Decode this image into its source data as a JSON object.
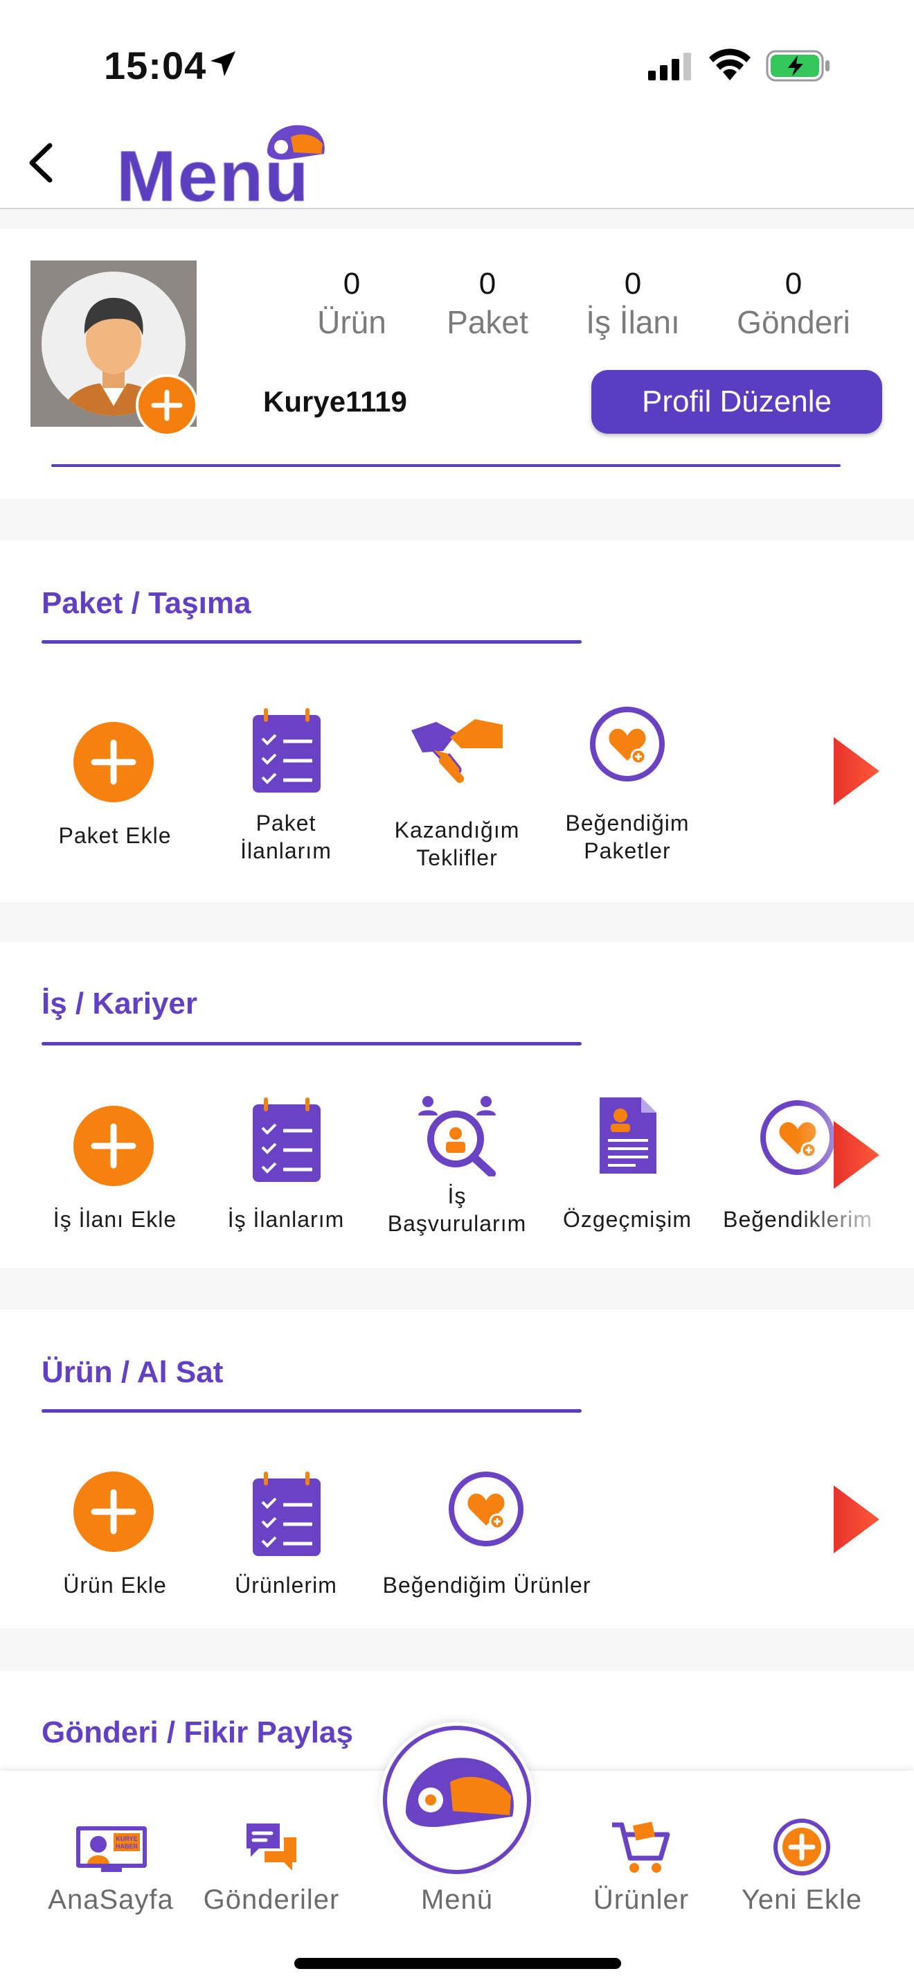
{
  "status_bar": {
    "time": "15:04"
  },
  "header": {
    "logo_text": "Menu"
  },
  "profile": {
    "username": "Kurye1119",
    "edit_label": "Profil Düzenle",
    "stats": [
      {
        "value": "0",
        "label": "Ürün"
      },
      {
        "value": "0",
        "label": "Paket"
      },
      {
        "value": "0",
        "label": "İş İlanı"
      },
      {
        "value": "0",
        "label": "Gönderi"
      }
    ]
  },
  "sections": [
    {
      "title": "Paket / Taşıma",
      "items": [
        {
          "line1": "Paket Ekle",
          "line2": "",
          "icon": "plus-icon"
        },
        {
          "line1": "Paket",
          "line2": "İlanlarım",
          "icon": "clipboard-list-icon"
        },
        {
          "line1": "Kazandığım",
          "line2": "Teklifler",
          "icon": "handshake-icon"
        },
        {
          "line1": "Beğendiğim",
          "line2": "Paketler",
          "icon": "heart-plus-icon"
        }
      ]
    },
    {
      "title": "İş / Kariyer",
      "items": [
        {
          "line1": "İş İlanı Ekle",
          "line2": "",
          "icon": "plus-icon"
        },
        {
          "line1": "İş İlanlarım",
          "line2": "",
          "icon": "clipboard-list-icon"
        },
        {
          "line1": "İş",
          "line2": "Başvurularım",
          "icon": "applicant-search-icon"
        },
        {
          "line1": "Özgeçmişim",
          "line2": "",
          "icon": "resume-icon"
        },
        {
          "line1": "Beğendiklerim",
          "line2": "",
          "icon": "heart-plus-icon"
        }
      ]
    },
    {
      "title": "Ürün / Al Sat",
      "items": [
        {
          "line1": "Ürün Ekle",
          "line2": "",
          "icon": "plus-icon"
        },
        {
          "line1": "Ürünlerim",
          "line2": "",
          "icon": "clipboard-list-icon"
        },
        {
          "line1": "Beğendiğim Ürünler",
          "line2": "",
          "icon": "heart-plus-icon"
        }
      ]
    },
    {
      "title": "Gönderi / Fikir Paylaş",
      "items": []
    }
  ],
  "bottom_nav": {
    "items": [
      {
        "label": "AnaSayfa",
        "icon": "news-screen-icon",
        "badge": "KURYE HABER"
      },
      {
        "label": "Gönderiler",
        "icon": "chat-bubbles-icon"
      },
      {
        "label": "Menü",
        "icon": "helmet-icon"
      },
      {
        "label": "Ürünler",
        "icon": "cart-icon"
      },
      {
        "label": "Yeni Ekle",
        "icon": "add-circle-icon"
      }
    ]
  },
  "colors": {
    "accent": "#5b3dc2",
    "orange": "#f7810f",
    "arrow_red": "#e8322c"
  }
}
